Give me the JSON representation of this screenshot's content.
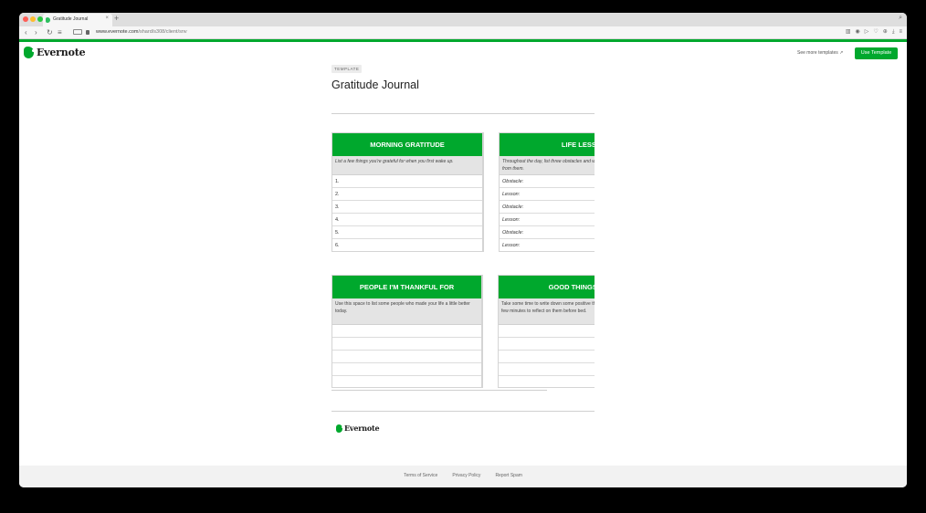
{
  "browser": {
    "tab_title": "Gratitude Journal",
    "new_tab": "+",
    "tab_close": "×",
    "back": "‹",
    "forward": "›",
    "reload": "↻",
    "reader": "≡",
    "url_domain": "www.evernote.com",
    "url_path": "/shard/s308/client/snv",
    "search": "⌕",
    "toolbar_icons": [
      "▥",
      "◉",
      "▷",
      "♡",
      "⊕",
      "⤓",
      "≡"
    ]
  },
  "header": {
    "logo_text": "Evernote",
    "see_more": "See more templates ↗",
    "use_template": "Use Template"
  },
  "document": {
    "badge": "TEMPLATE",
    "title": "Gratitude Journal"
  },
  "cards": {
    "morning": {
      "title": "MORNING GRATITUDE",
      "description": "List a few things you're grateful for when you first wake up.",
      "rows": [
        "1.",
        "2.",
        "3.",
        "4.",
        "5.",
        "6."
      ]
    },
    "life": {
      "title": "LIFE LESSONS",
      "description": "Throughout the day, list three obstacles and what you're learning from them.",
      "rows": [
        "Obstacle:",
        "Lesson:",
        "Obstacle:",
        "Lesson:",
        "Obstacle:",
        "Lesson:"
      ]
    },
    "people": {
      "title": "PEOPLE I'M THANKFUL FOR",
      "description": "Use this space to list some people who made your life a little better today."
    },
    "good": {
      "title": "GOOD THINGS TODAY",
      "description": "Take some time to write down some positive things about today. Take a few minutes to reflect on them before bed."
    }
  },
  "footer": {
    "logo_text": "Evernote",
    "links": [
      "Terms of Service",
      "Privacy Policy",
      "Report Spam"
    ]
  },
  "colors": {
    "brand_green": "#00a82d",
    "description_bg": "#e4e4e4"
  }
}
